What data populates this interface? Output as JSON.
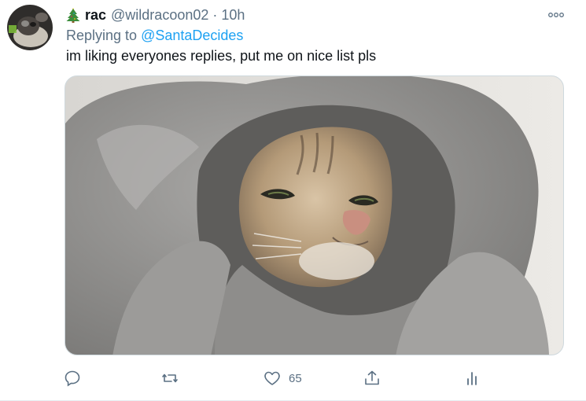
{
  "tweet": {
    "display_name": "rac",
    "handle": "@wildracoon02",
    "separator": "·",
    "time": "10h",
    "replying_prefix": "Replying to",
    "replying_to": "@SantaDecides",
    "text": "im liking everyones replies, put me on nice list pls",
    "media_alt": "cat wrapped in grey blanket",
    "counts": {
      "reply": "",
      "retweet": "",
      "like": "65",
      "share": "",
      "analytics": ""
    }
  },
  "icons": {
    "name_emoji": "christmas-tree-icon",
    "more": "more-icon",
    "reply": "reply-icon",
    "retweet": "retweet-icon",
    "like": "heart-icon",
    "share": "share-icon",
    "analytics": "analytics-icon"
  },
  "colors": {
    "text": "#0f1419",
    "secondary": "#5b7083",
    "link": "#1da1f2",
    "border": "#cfd9de"
  }
}
